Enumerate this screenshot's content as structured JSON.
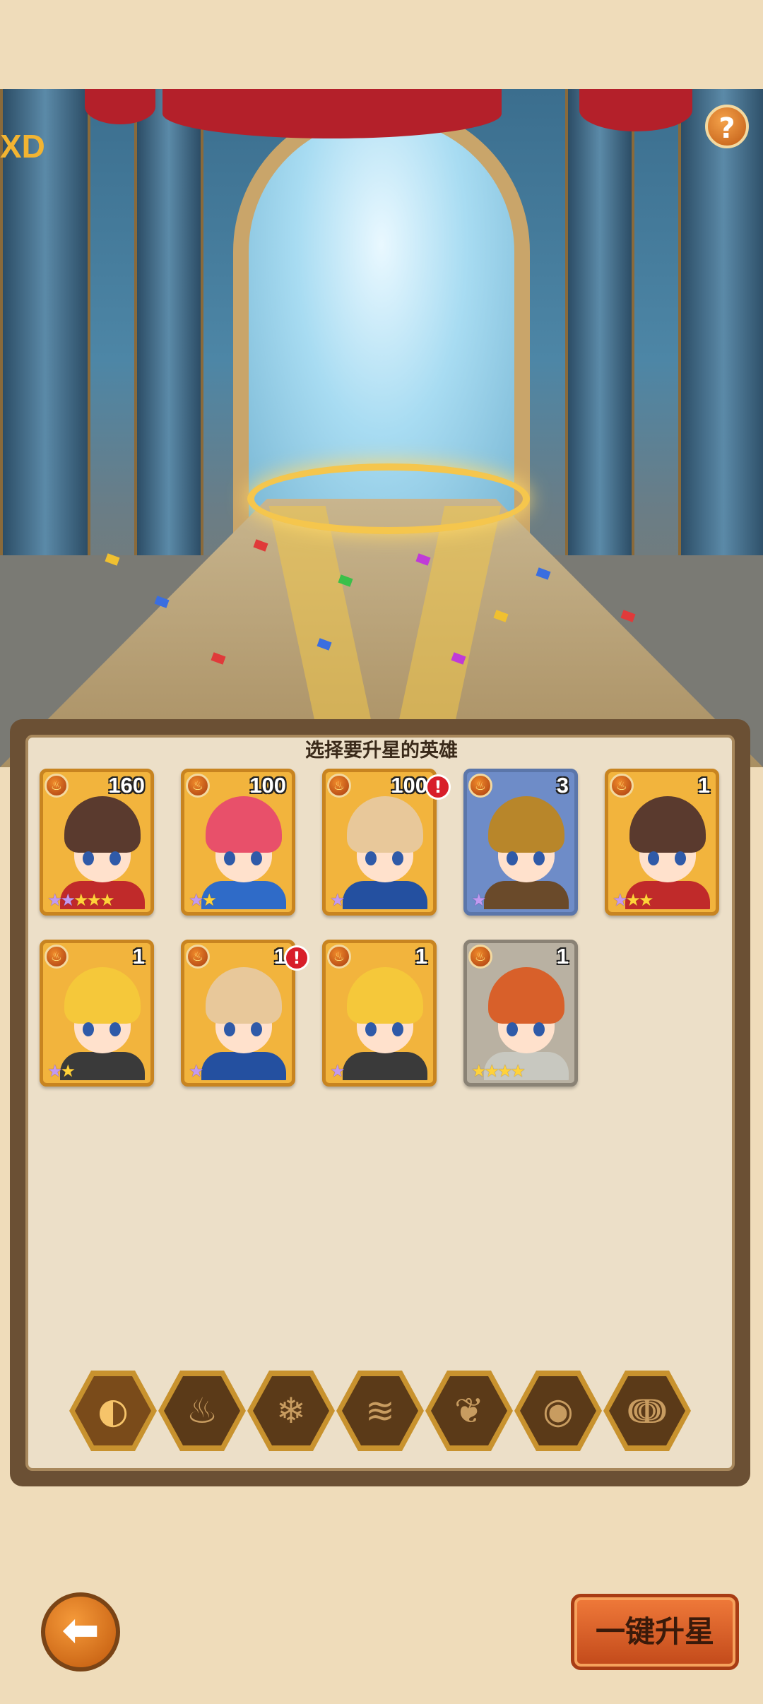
{
  "header": {
    "help_label": "?",
    "side_label": "XD"
  },
  "panel": {
    "title": "选择要升星的英雄"
  },
  "heroes": [
    {
      "count": "160",
      "stars": [
        {
          "c": "p"
        },
        {
          "c": "p"
        },
        {
          "c": "g"
        },
        {
          "c": "g"
        },
        {
          "c": "g"
        }
      ],
      "alert": false,
      "frame": "gold"
    },
    {
      "count": "100",
      "stars": [
        {
          "c": "p"
        },
        {
          "c": "g"
        }
      ],
      "alert": false,
      "frame": "gold"
    },
    {
      "count": "100",
      "stars": [
        {
          "c": "p"
        }
      ],
      "alert": true,
      "frame": "gold"
    },
    {
      "count": "3",
      "stars": [
        {
          "c": "p"
        }
      ],
      "alert": false,
      "frame": "blue"
    },
    {
      "count": "1",
      "stars": [
        {
          "c": "p"
        },
        {
          "c": "g"
        },
        {
          "c": "g"
        }
      ],
      "alert": false,
      "frame": "gold"
    },
    {
      "count": "1",
      "stars": [
        {
          "c": "p"
        },
        {
          "c": "g"
        }
      ],
      "alert": false,
      "frame": "gold"
    },
    {
      "count": "1",
      "stars": [
        {
          "c": "p"
        }
      ],
      "alert": true,
      "frame": "gold"
    },
    {
      "count": "1",
      "stars": [
        {
          "c": "p"
        }
      ],
      "alert": false,
      "frame": "gold"
    },
    {
      "count": "1",
      "stars": [
        {
          "c": "g"
        },
        {
          "c": "g"
        },
        {
          "c": "g"
        },
        {
          "c": "g"
        }
      ],
      "alert": false,
      "frame": "gray"
    }
  ],
  "element_filters": [
    {
      "icon": "all-elements-icon",
      "glyph": "◐",
      "active": true
    },
    {
      "icon": "fire-icon",
      "glyph": "♨",
      "active": false
    },
    {
      "icon": "ice-icon",
      "glyph": "❄",
      "active": false
    },
    {
      "icon": "wind-icon",
      "glyph": "≋",
      "active": false
    },
    {
      "icon": "nature-icon",
      "glyph": "❦",
      "active": false
    },
    {
      "icon": "dark-eye-icon",
      "glyph": "◉",
      "active": false
    },
    {
      "icon": "spiral-icon",
      "glyph": "ↈ",
      "active": false
    }
  ],
  "footer": {
    "back_glyph": "⬅",
    "one_click_label": "一键升星"
  }
}
